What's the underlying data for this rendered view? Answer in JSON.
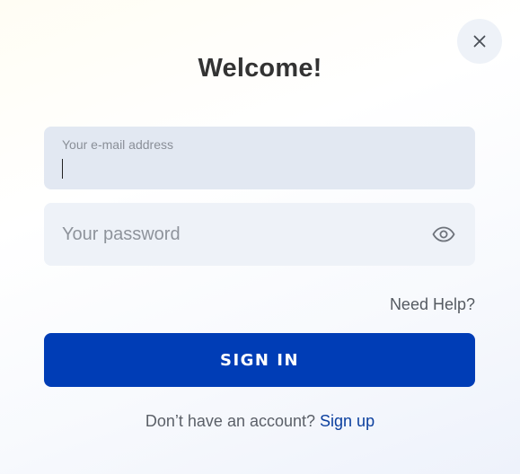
{
  "modal": {
    "title": "Welcome!",
    "close_icon": "close-icon"
  },
  "email_field": {
    "label": "Your e-mail address",
    "value": "",
    "focused": true
  },
  "password_field": {
    "placeholder": "Your password",
    "value": "",
    "toggle_icon": "eye-icon"
  },
  "help_link": "Need Help?",
  "sign_in_button": "SIGN IN",
  "signup": {
    "prompt": "Don’t have an account?",
    "link": "Sign up"
  },
  "colors": {
    "primary_button": "#003db6",
    "link": "#0b3f9e",
    "email_field_bg": "#e2e8f2",
    "password_field_bg": "#eef2f8",
    "close_button_bg": "#eef2f8"
  }
}
